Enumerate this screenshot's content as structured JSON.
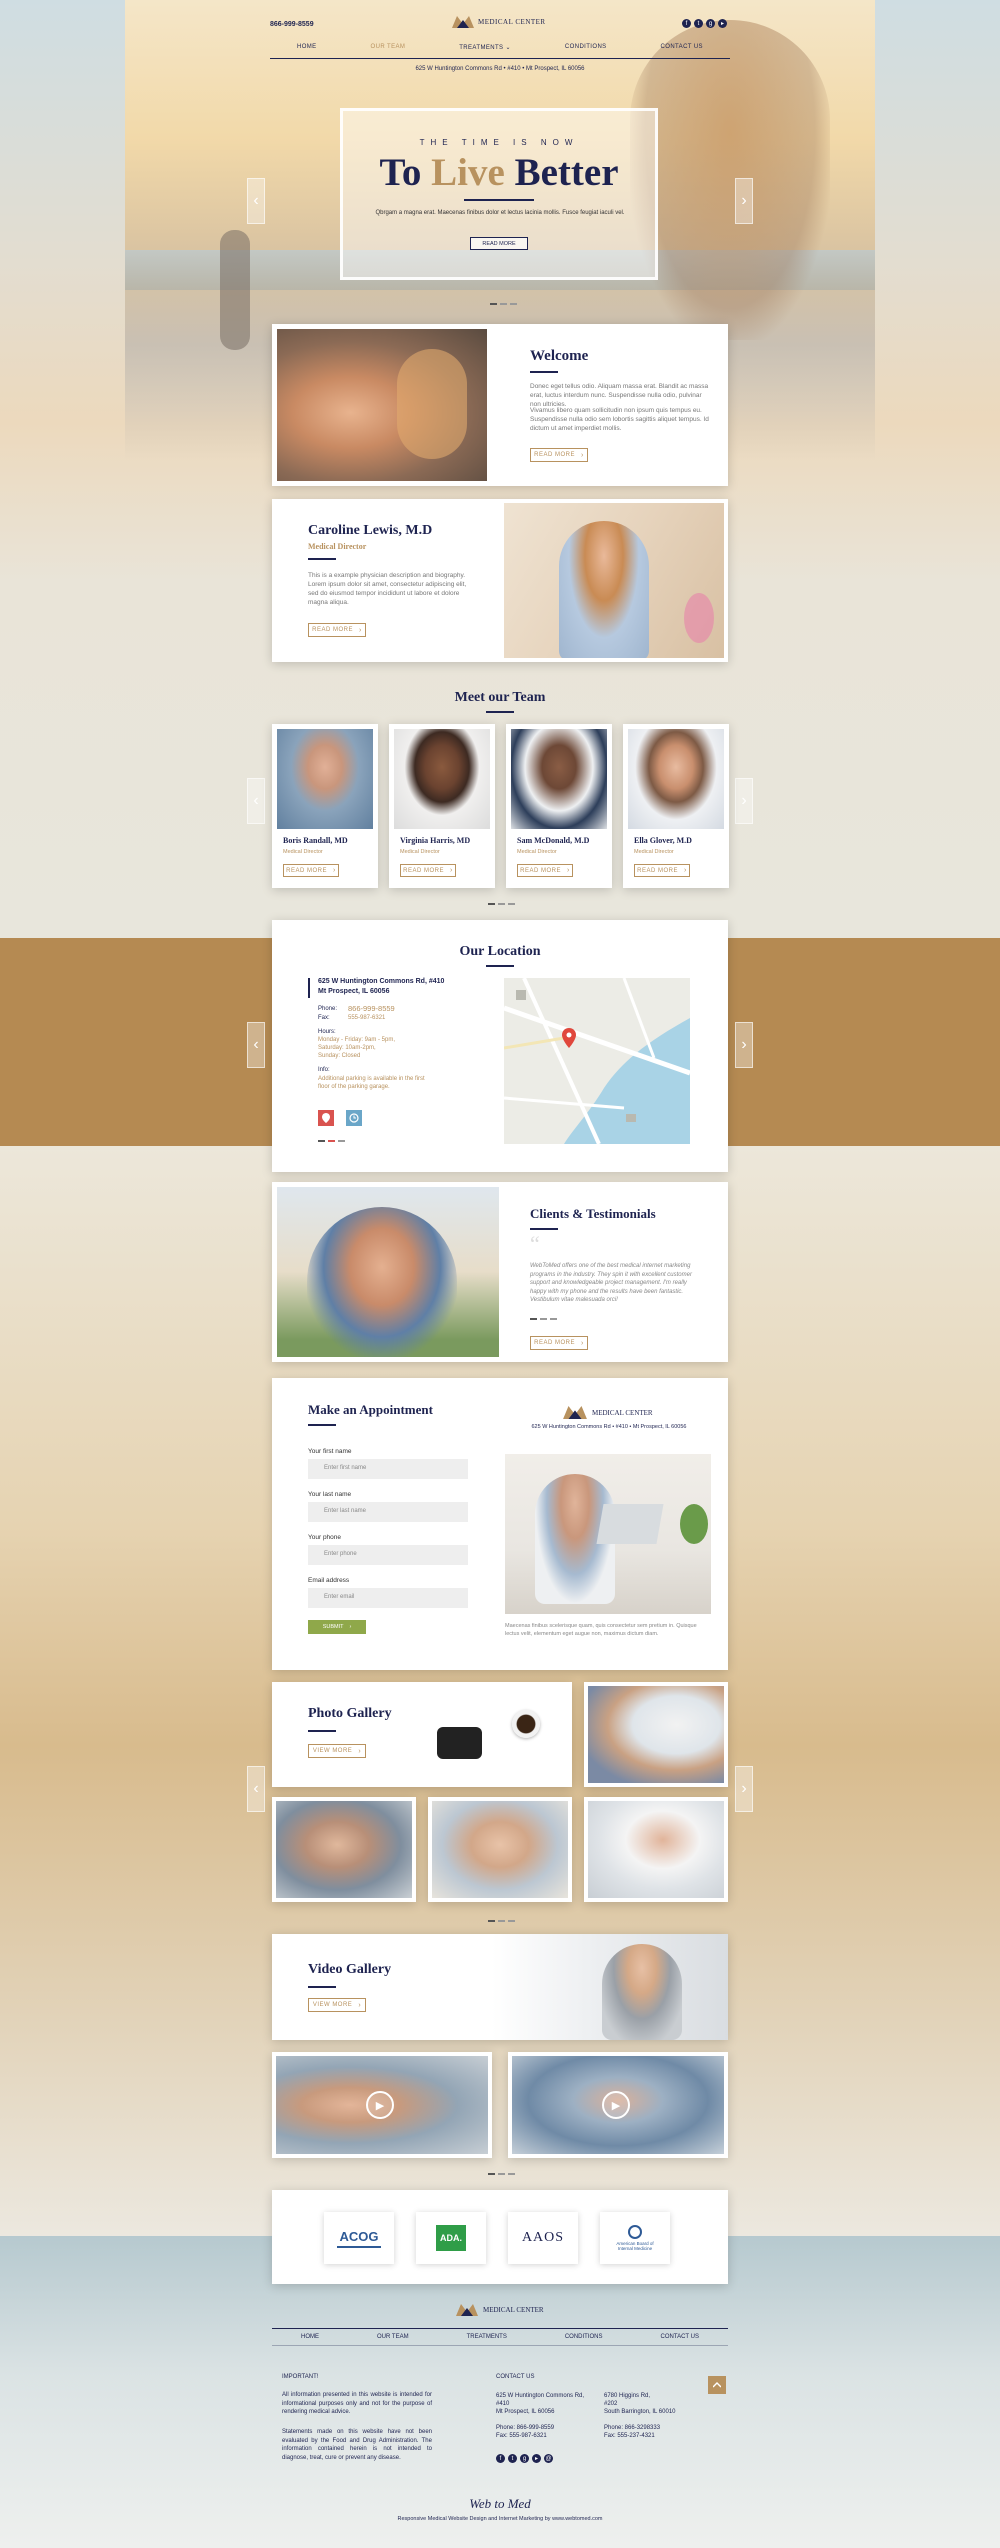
{
  "header": {
    "phone": "866-999-8559",
    "brand": "MEDICAL CENTER",
    "nav": [
      "HOME",
      "OUR TEAM",
      "TREATMENTS",
      "CONDITIONS",
      "CONTACT US"
    ],
    "address": "625 W Huntington Commons Rd • #410 • Mt Prospect, IL 60056"
  },
  "hero": {
    "kicker": "THE TIME IS NOW",
    "title_a": "To",
    "title_b": "Live",
    "title_c": "Better",
    "text": "Qbrgam a magna erat. Maecenas finibus dolor et lectus lacinia mollis. Fusce feugiat iaculi vel.",
    "button": "READ MORE"
  },
  "welcome": {
    "title": "Welcome",
    "p1": "Donec eget tellus odio. Aliquam massa erat. Blandit ac massa erat, luctus interdum nunc. Suspendisse nulla odio, pulvinar non ultricies.",
    "p2": "Vivamus libero quam sollicitudin non ipsum quis tempus eu. Suspendisse nulla odio sem lobortis sagittis aliquet tempus. Id dictum ut amet imperdiet mollis.",
    "button": "READ MORE"
  },
  "director": {
    "name": "Caroline Lewis, M.D",
    "role": "Medical Director",
    "text": "This is a example physician description and biography. Lorem ipsum dolor sit amet, consectetur adipiscing elit, sed do eiusmod tempor incididunt ut labore et dolore magna aliqua.",
    "button": "READ MORE"
  },
  "team": {
    "title": "Meet our Team",
    "members": [
      {
        "name": "Boris Randall, MD",
        "role": "Medical Director",
        "button": "READ MORE"
      },
      {
        "name": "Virginia Harris, MD",
        "role": "Medical Director",
        "button": "READ MORE"
      },
      {
        "name": "Sam McDonald, M.D",
        "role": "Medical Director",
        "button": "READ MORE"
      },
      {
        "name": "Ella Glover, M.D",
        "role": "Medical Director",
        "button": "READ MORE"
      }
    ]
  },
  "location": {
    "title": "Our Location",
    "address1": "625 W Huntington Commons Rd, #410",
    "address2": "Mt Prospect, IL 60056",
    "phone_label": "Phone:",
    "phone": "866-999-8559",
    "fax_label": "Fax:",
    "fax": "555-987-6321",
    "hours_label": "Hours:",
    "hours": [
      "Monday - Friday: 9am - 5pm,",
      "Saturday: 10am-2pm,",
      "Sunday: Closed"
    ],
    "info_label": "Info:",
    "info": "Additional parking is available in the first floor of the parking garage."
  },
  "testimonials": {
    "title": "Clients & Testimonials",
    "quote": "WebToMed offers one of the best medical internet marketing programs in the industry. They spin it with excellent customer support and knowledgeable project management. I'm really happy with my phone and the results have been fantastic. Vestibulum vitae malesuada orci!",
    "button": "READ MORE"
  },
  "appointment": {
    "title": "Make an Appointment",
    "brand": "MEDICAL CENTER",
    "address": "625 W Huntington Commons Rd • #410 • Mt Prospect, IL 60056",
    "fields": [
      {
        "label": "Your first name",
        "placeholder": "Enter first name"
      },
      {
        "label": "Your last name",
        "placeholder": "Enter last name"
      },
      {
        "label": "Your phone",
        "placeholder": "Enter phone"
      },
      {
        "label": "Email address",
        "placeholder": "Enter email"
      }
    ],
    "submit": "SUBMIT",
    "caption": "Maecenas finibus scelerisque quam, quis consectetur sem pretium in. Quisque lectus velit, elementum eget augue non, maximus dictum diam."
  },
  "photo_gallery": {
    "title": "Photo Gallery",
    "button": "VIEW MORE"
  },
  "video_gallery": {
    "title": "Video Gallery",
    "button": "VIEW MORE"
  },
  "partners": [
    "ACOG",
    "ADA.",
    "AAOS",
    "American Board of Internal Medicine"
  ],
  "footer": {
    "brand": "MEDICAL CENTER",
    "nav": [
      "HOME",
      "OUR TEAM",
      "TREATMENTS",
      "CONDITIONS",
      "CONTACT US"
    ],
    "important_title": "IMPORTANT!",
    "important_1": "All information presented in this website is intended for informational purposes only and not for the purpose of rendering medical advice.",
    "important_2": "Statements made on this website have not been evaluated by the Food and Drug Administration. The information contained herein is not intended to diagnose, treat, cure or prevent any disease.",
    "contact_title": "CONTACT US",
    "addr_a": [
      "625 W Huntington Commons Rd,",
      "#410",
      "Mt Prospect, IL 60056"
    ],
    "addr_b": [
      "6780 Higgins Rd,",
      "#202",
      "South Barrington, IL 60010"
    ],
    "phone_a": "Phone: 866-999-8559",
    "fax_a": "Fax: 555-987-6321",
    "phone_b": "Phone: 866-3298333",
    "fax_b": "Fax: 555-237-4321",
    "logo": "Web to Med",
    "credit": "Responsive Medical Website Design and Internet Marketing by www.webtomed.com"
  },
  "colors": {
    "navy": "#1e2350",
    "gold": "#b8925f",
    "band": "#b58a52",
    "green": "#8fa84a"
  }
}
